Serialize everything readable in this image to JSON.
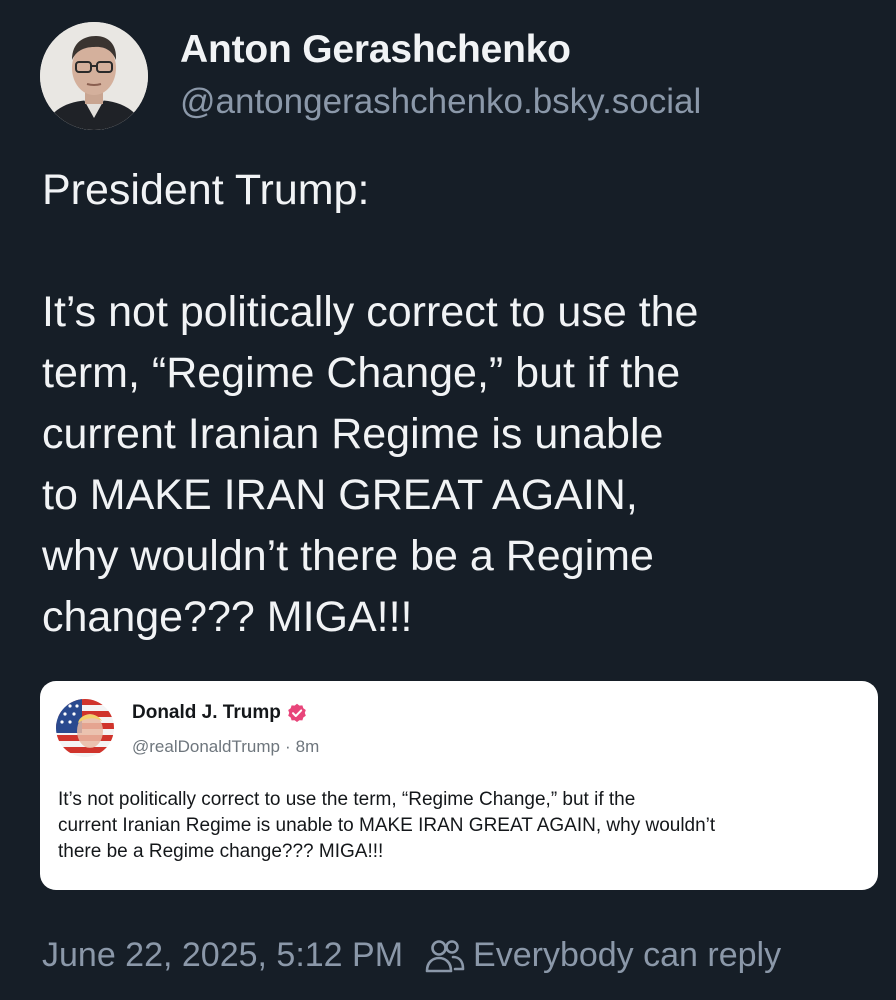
{
  "author": {
    "name": "Anton Gerashchenko",
    "handle": "@antongerashchenko.bsky.social"
  },
  "post": {
    "lines": [
      "President Trump:",
      "",
      "It’s not politically correct to use the",
      "term, “Regime Change,” but if the",
      "current Iranian Regime is unable",
      "to MAKE IRAN GREAT AGAIN,",
      "why wouldn’t there be a Regime",
      "change??? MIGA!!!"
    ]
  },
  "embed": {
    "name": "Donald J. Trump",
    "handle": "@realDonaldTrump",
    "separator": "·",
    "time": "8m",
    "lines": [
      "It’s not politically correct to use the term, “Regime Change,” but if the",
      "current Iranian Regime is unable to MAKE IRAN GREAT AGAIN, why wouldn’t",
      "there be a Regime change??? MIGA!!!"
    ],
    "badge_icon": "verified-badge-icon",
    "badge_color": "#e8457a"
  },
  "footer": {
    "timestamp": "June 22, 2025, 5:12 PM",
    "reply_setting": "Everybody can reply",
    "reply_icon": "people-icon"
  },
  "colors": {
    "background": "#161e27",
    "muted_text": "#8b98a9",
    "primary_text": "#f1f3f5"
  }
}
